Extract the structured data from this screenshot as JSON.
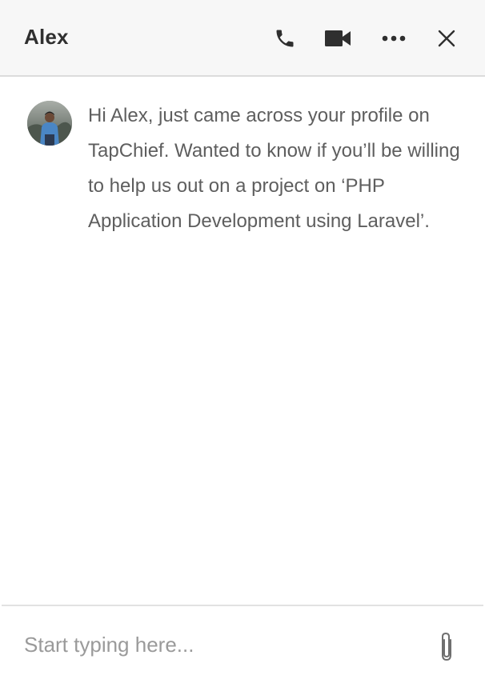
{
  "header": {
    "title": "Alex",
    "icons": [
      "phone-icon",
      "video-camera-icon",
      "more-options-icon",
      "close-icon"
    ]
  },
  "conversation": {
    "message": {
      "avatar_icon": "user-avatar",
      "text": "Hi Alex, just came across your profile on TapChief. Wanted to know if you’ll be willing to help us out on a project on ‘PHP Application Development using Laravel’."
    }
  },
  "composer": {
    "placeholder": "Start typing here...",
    "value": "",
    "attach_icon": "paperclip-icon"
  },
  "colors": {
    "header_bg": "#f7f7f7",
    "title": "#2f2f2f",
    "message_text": "#5e5e5e",
    "icon": "#2f2f2f",
    "placeholder": "#9a9a9a"
  }
}
